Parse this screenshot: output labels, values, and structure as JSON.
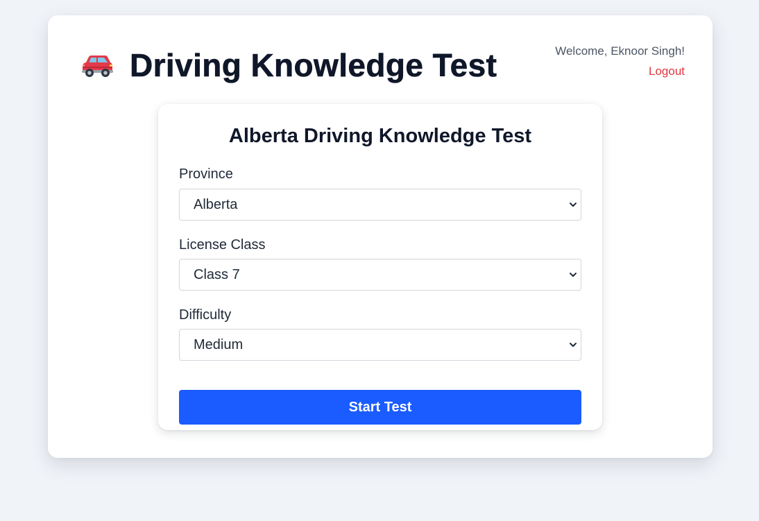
{
  "header": {
    "title": "Driving Knowledge Test",
    "icon": "car-icon",
    "welcome": "Welcome, Eknoor Singh!",
    "logout_label": "Logout"
  },
  "form": {
    "title": "Alberta Driving Knowledge Test",
    "province": {
      "label": "Province",
      "value": "Alberta"
    },
    "license_class": {
      "label": "License Class",
      "value": "Class 7"
    },
    "difficulty": {
      "label": "Difficulty",
      "value": "Medium"
    },
    "start_label": "Start Test"
  },
  "colors": {
    "background": "#f0f3f8",
    "card": "#ffffff",
    "primary_button": "#1a5cff",
    "logout": "#e2353e",
    "title_text": "#0f1729"
  }
}
